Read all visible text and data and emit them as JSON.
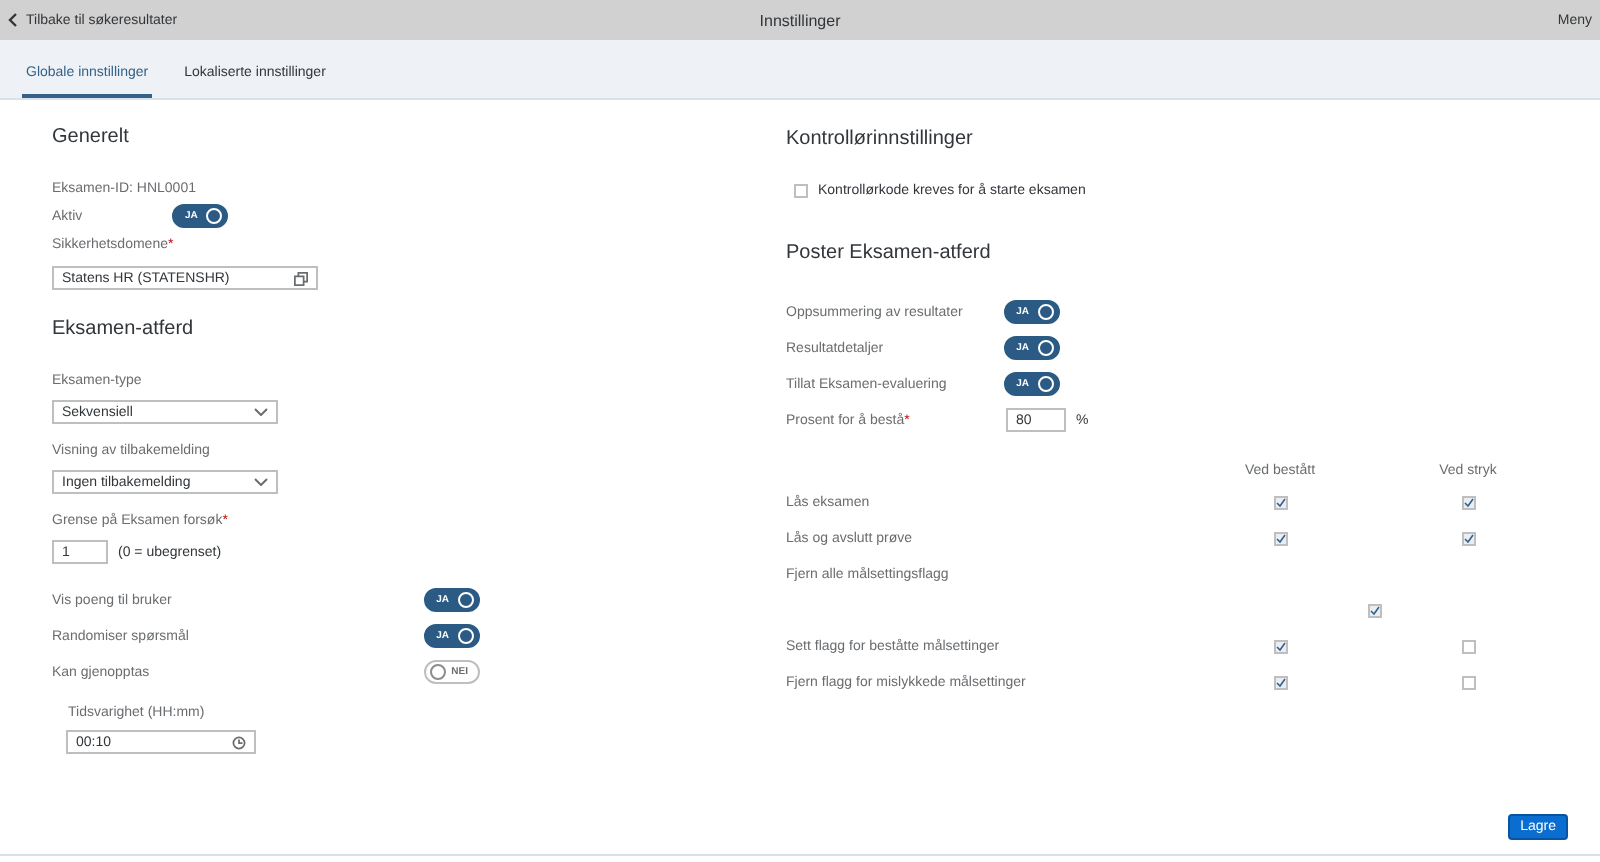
{
  "header": {
    "back": "Tilbake til søkeresultater",
    "title": "Innstillinger",
    "menu": "Meny"
  },
  "tabs": [
    {
      "label": "Globale innstillinger",
      "selected": true
    },
    {
      "label": "Lokaliserte innstillinger",
      "selected": false
    }
  ],
  "general": {
    "heading": "Generelt",
    "exam_id": "Eksamen-ID: HNL0001",
    "active": {
      "label": "Aktiv",
      "on": true,
      "text": "JA"
    },
    "domain": {
      "label": "Sikkerhetsdomene",
      "required": "*",
      "value": "Statens HR (STATENSHR)"
    }
  },
  "behavior": {
    "heading": "Eksamen-atferd",
    "exam_type": {
      "label": "Eksamen-type",
      "value": "Sekvensiell"
    },
    "feedback": {
      "label": "Visning av tilbakemelding",
      "value": "Ingen tilbakemelding"
    },
    "attempts": {
      "label": "Grense på Eksamen forsøk",
      "required": "*",
      "value": "1",
      "hint": "(0 = ubegrenset)"
    },
    "toggles": [
      {
        "label": "Vis poeng til bruker",
        "on": true,
        "text": "JA"
      },
      {
        "label": "Randomiser spørsmål",
        "on": true,
        "text": "JA"
      },
      {
        "label": "Kan gjenopptas",
        "on": false,
        "text": "NEI"
      }
    ],
    "duration": {
      "label": "Tidsvarighet (HH:mm)",
      "value": "00:10"
    }
  },
  "proctor": {
    "heading": "Kontrollørinnstillinger",
    "checkbox": {
      "label": "Kontrollørkode kreves for å starte eksamen",
      "checked": false
    }
  },
  "post": {
    "heading": "Poster Eksamen-atferd",
    "toggles": [
      {
        "label": "Oppsummering av resultater",
        "on": true,
        "text": "JA"
      },
      {
        "label": "Resultatdetaljer",
        "on": true,
        "text": "JA"
      },
      {
        "label": "Tillat Eksamen-evaluering",
        "on": true,
        "text": "JA"
      }
    ],
    "percent": {
      "label": "Prosent for å bestå",
      "required": "*",
      "value": "80",
      "unit": "%"
    },
    "columns": [
      "Ved bestått",
      "Ved stryk"
    ],
    "rows": [
      {
        "kind": "pair",
        "label": "Lås eksamen",
        "checks": [
          true,
          true
        ]
      },
      {
        "kind": "pair",
        "label": "Lås og avslutt prøve",
        "checks": [
          true,
          true
        ]
      },
      {
        "kind": "merged",
        "label": "Fjern alle målsettingsflagg",
        "checked": true
      },
      {
        "kind": "pair",
        "label": "Sett flagg for beståtte målsettinger",
        "checks": [
          true,
          false
        ]
      },
      {
        "kind": "pair",
        "label": "Fjern flagg for mislykkede målsettinger",
        "checks": [
          true,
          false
        ]
      }
    ]
  },
  "save": "Lagre"
}
